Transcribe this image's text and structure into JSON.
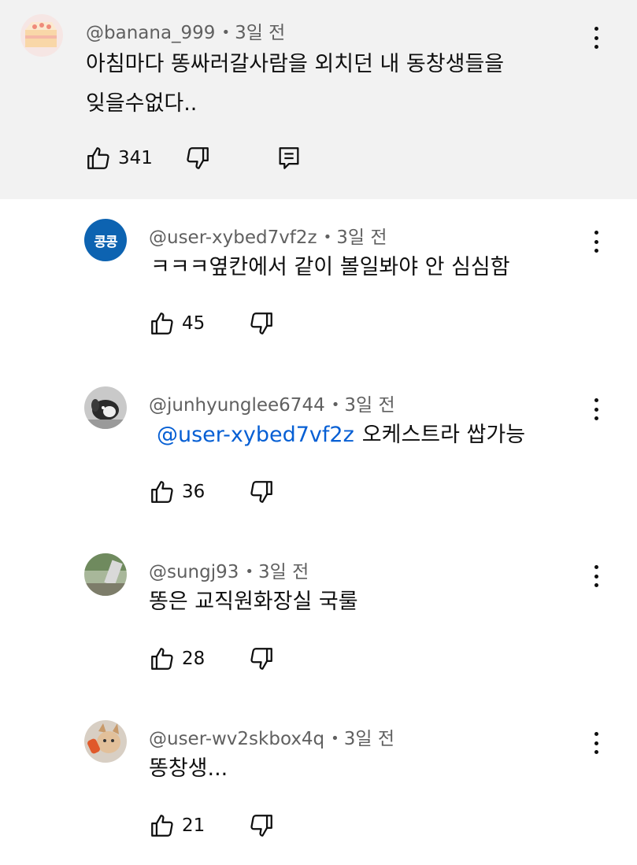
{
  "parent_comment": {
    "handle": "@banana_999",
    "separator": "•",
    "time": "3일 전",
    "lines": [
      "아침마다 똥싸러갈사람을 외치던 내 동창생들을",
      "잊을수없다.."
    ],
    "likes": "341",
    "avatar_icon": "cake-avatar",
    "reply_icon": "reply-icon"
  },
  "replies": [
    {
      "handle": "@user-xybed7vf2z",
      "separator": "•",
      "time": "3일 전",
      "avatar_text": "콩콩",
      "avatar_color": "#0d63b1",
      "text": "ㅋㅋㅋ옆칸에서 같이 볼일봐야 안 심심함",
      "likes": "45"
    },
    {
      "handle": "@junhyunglee6744",
      "separator": "•",
      "time": "3일 전",
      "avatar_icon": "dog-avatar",
      "mention": "@user-xybed7vf2z",
      "text": "오케스트라 쌉가능",
      "likes": "36"
    },
    {
      "handle": "@sungj93",
      "separator": "•",
      "time": "3일 전",
      "avatar_icon": "photo-avatar",
      "text": "똥은 교직원화장실 국룰",
      "likes": "28"
    },
    {
      "handle": "@user-wv2skbox4q",
      "separator": "•",
      "time": "3일 전",
      "avatar_icon": "cat-avatar",
      "text": "똥창생...",
      "likes": "21"
    }
  ],
  "colors": {
    "parent_background": "#f2f2f2",
    "meta_text": "#606060",
    "mention": "#065fd4"
  }
}
